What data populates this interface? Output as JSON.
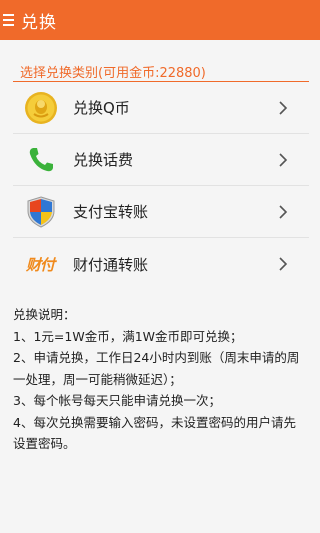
{
  "header": {
    "title": "兑换",
    "menu_icon": "hamburger-menu-icon"
  },
  "section": {
    "label": "选择兑换类别(可用金币:22880)"
  },
  "options": [
    {
      "label": "兑换Q币",
      "icon": "qq-coin-icon"
    },
    {
      "label": "兑换话费",
      "icon": "phone-handset-icon"
    },
    {
      "label": "支付宝转账",
      "icon": "shield-windows-icon"
    },
    {
      "label": "财付通转账",
      "icon": "tenpay-logo-icon"
    }
  ],
  "instructions": {
    "title": "兑换说明：",
    "items": [
      "1、1元=1W金币，满1W金币即可兑换；",
      "2、申请兑换，工作日24小时内到账（周末申请的周一处理，周一可能稍微延迟）；",
      "3、每个帐号每天只能申请兑换一次；",
      "4、每次兑换需要输入密码，未设置密码的用户请先设置密码。"
    ]
  },
  "colors": {
    "accent": "#f06a2a",
    "background": "#f5f5f5"
  }
}
